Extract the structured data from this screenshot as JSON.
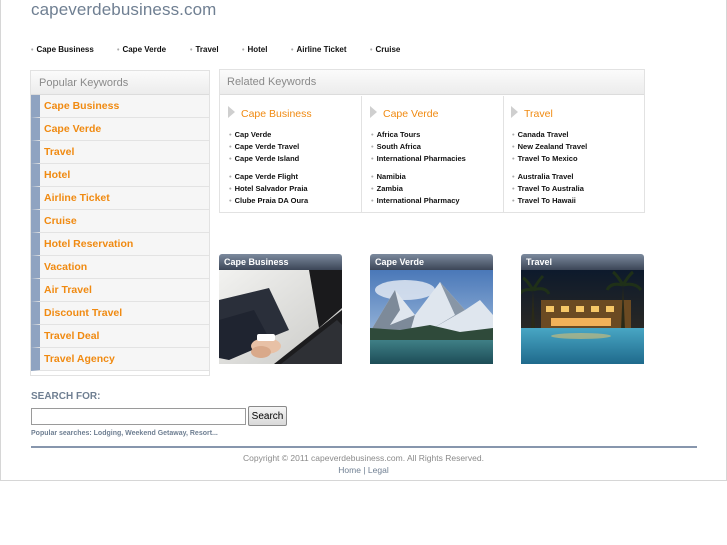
{
  "site": {
    "domain": "capeverdebusiness.com"
  },
  "topnav": [
    "Cape Business",
    "Cape Verde",
    "Travel",
    "Hotel",
    "Airline Ticket",
    "Cruise"
  ],
  "sidebar": {
    "heading": "Popular Keywords",
    "items": [
      "Cape Business",
      "Cape Verde",
      "Travel",
      "Hotel",
      "Airline Ticket",
      "Cruise",
      "Hotel Reservation",
      "Vacation",
      "Air Travel",
      "Discount Travel",
      "Travel Deal",
      "Travel Agency"
    ]
  },
  "related": {
    "heading": "Related Keywords",
    "columns": [
      {
        "title": "Cape Business",
        "links": [
          "Cap Verde",
          "Cape Verde Travel",
          "Cape Verde Island",
          "Cape Verde Flight",
          "Hotel Salvador Praia",
          "Clube Praia DA Oura"
        ]
      },
      {
        "title": "Cape Verde",
        "links": [
          "Africa Tours",
          "South Africa",
          "International Pharmacies",
          "Namibia",
          "Zambia",
          "International Pharmacy"
        ]
      },
      {
        "title": "Travel",
        "links": [
          "Canada Travel",
          "New Zealand Travel",
          "Travel To Mexico",
          "Australia Travel",
          "Travel To Australia",
          "Travel To Hawaii"
        ]
      }
    ]
  },
  "tiles": [
    {
      "label": "Cape Business"
    },
    {
      "label": "Cape Verde"
    },
    {
      "label": "Travel"
    }
  ],
  "search": {
    "label": "SEARCH FOR:",
    "value": "",
    "button": "Search",
    "popular_prefix": "Popular searches:",
    "popular_items": [
      "Lodging",
      "Weekend Getaway",
      "Resort..."
    ]
  },
  "footer": {
    "copyright": "Copyright © 2011 capeverdebusiness.com. All Rights Reserved.",
    "links": [
      "Home",
      "Legal"
    ]
  },
  "colors": {
    "accent_orange": "#f08a11",
    "heading_blue": "#6f7f92",
    "sidebar_bar": "#8fa3c1"
  }
}
